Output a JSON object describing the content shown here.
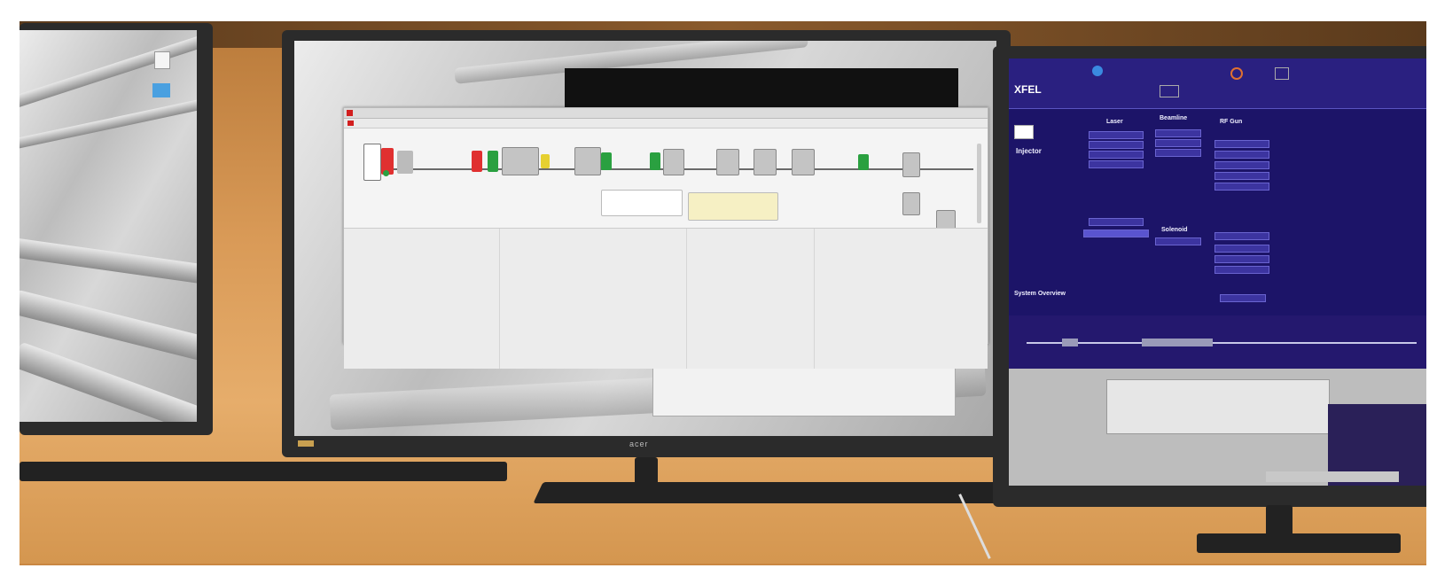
{
  "scene": {
    "description": "",
    "monitor_brand": "acer",
    "xfel_app": {
      "logo": "XFEL",
      "section_title": "Injector",
      "columns": [
        "Laser",
        "Beamline",
        "RF Gun"
      ],
      "sub_sections": [
        "Solenoid"
      ],
      "overview_title": "System Overview"
    },
    "colors": {
      "desk": "#d99850",
      "xfel_background": "#1c1468",
      "accent_red": "#d21f1f"
    }
  }
}
